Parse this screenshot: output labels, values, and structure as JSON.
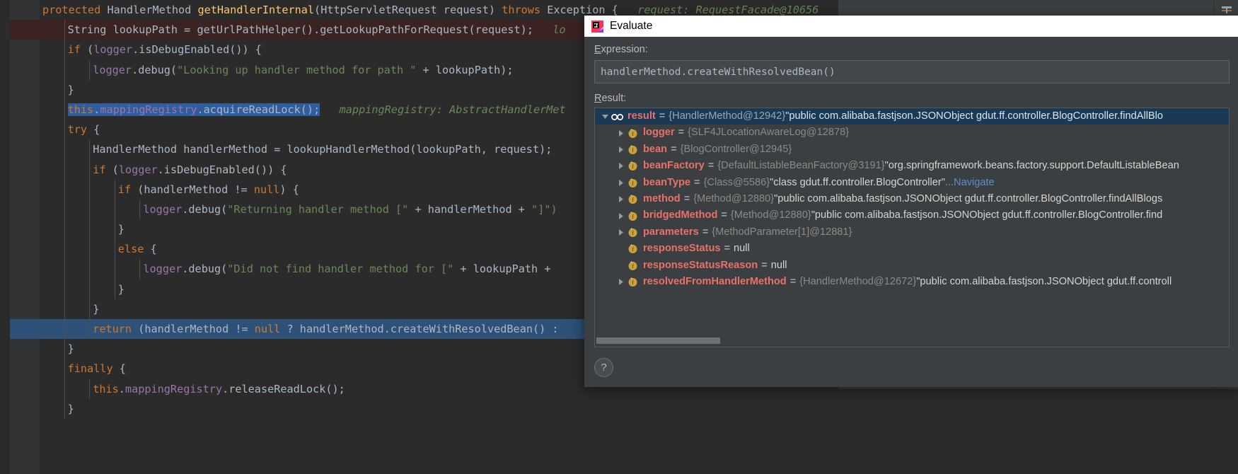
{
  "editor": {
    "language": "java",
    "lines": [
      {
        "indent": 0,
        "highlight": "none",
        "tokens": [
          {
            "t": "protected ",
            "c": "kw"
          },
          {
            "t": "HandlerMethod ",
            "c": "id"
          },
          {
            "t": "getHandlerInternal",
            "c": "fn"
          },
          {
            "t": "(HttpServletRequest request) ",
            "c": "id"
          },
          {
            "t": "throws ",
            "c": "kw"
          },
          {
            "t": "Exception {",
            "c": "id"
          },
          {
            "t": "   request: RequestFacade@10656",
            "c": "inl"
          }
        ]
      },
      {
        "indent": 1,
        "highlight": "brown",
        "tokens": [
          {
            "t": "String lookupPath = ",
            "c": "id"
          },
          {
            "t": "getUrlPathHelper",
            "c": "id"
          },
          {
            "t": "().",
            "c": "id"
          },
          {
            "t": "getLookupPathForRequest",
            "c": "id"
          },
          {
            "t": "(request); ",
            "c": "id"
          },
          {
            "t": "  lo",
            "c": "inl"
          }
        ]
      },
      {
        "indent": 1,
        "highlight": "none",
        "tokens": [
          {
            "t": "if ",
            "c": "kw"
          },
          {
            "t": "(",
            "c": "id"
          },
          {
            "t": "logger",
            "c": "fld"
          },
          {
            "t": ".isDebugEnabled()) {",
            "c": "id"
          }
        ]
      },
      {
        "indent": 2,
        "highlight": "none",
        "tokens": [
          {
            "t": "logger",
            "c": "fld"
          },
          {
            "t": ".debug(",
            "c": "id"
          },
          {
            "t": "\"Looking up handler method for path \"",
            "c": "str"
          },
          {
            "t": " + lookupPath);",
            "c": "id"
          }
        ]
      },
      {
        "indent": 1,
        "highlight": "none",
        "tokens": [
          {
            "t": "}",
            "c": "id"
          }
        ]
      },
      {
        "indent": 1,
        "highlight": "none",
        "selected": true,
        "tokens": [
          {
            "t": "this",
            "c": "kw"
          },
          {
            "t": ".",
            "c": "id"
          },
          {
            "t": "mappingRegistry",
            "c": "fld"
          },
          {
            "t": ".acquireReadLock();",
            "c": "id"
          }
        ],
        "inlay": "   mappingRegistry: AbstractHandlerMet"
      },
      {
        "indent": 1,
        "highlight": "none",
        "tokens": [
          {
            "t": "try ",
            "c": "kw"
          },
          {
            "t": "{",
            "c": "id"
          }
        ]
      },
      {
        "indent": 2,
        "highlight": "none",
        "tokens": [
          {
            "t": "HandlerMethod handlerMethod = lookupHandlerMethod(lookupPath, request);",
            "c": "id"
          }
        ]
      },
      {
        "indent": 2,
        "highlight": "none",
        "tokens": [
          {
            "t": "if ",
            "c": "kw"
          },
          {
            "t": "(",
            "c": "id"
          },
          {
            "t": "logger",
            "c": "fld"
          },
          {
            "t": ".isDebugEnabled()) {",
            "c": "id"
          }
        ]
      },
      {
        "indent": 3,
        "highlight": "none",
        "tokens": [
          {
            "t": "if ",
            "c": "kw"
          },
          {
            "t": "(handlerMethod != ",
            "c": "id"
          },
          {
            "t": "null",
            "c": "kw"
          },
          {
            "t": ") {",
            "c": "id"
          }
        ]
      },
      {
        "indent": 4,
        "highlight": "none",
        "tokens": [
          {
            "t": "logger",
            "c": "fld"
          },
          {
            "t": ".debug(",
            "c": "id"
          },
          {
            "t": "\"Returning handler method [\"",
            "c": "str"
          },
          {
            "t": " + handlerMethod + ",
            "c": "id"
          },
          {
            "t": "\"]\")",
            "c": "str"
          }
        ]
      },
      {
        "indent": 3,
        "highlight": "none",
        "tokens": [
          {
            "t": "}",
            "c": "id"
          }
        ]
      },
      {
        "indent": 3,
        "highlight": "none",
        "tokens": [
          {
            "t": "else ",
            "c": "kw"
          },
          {
            "t": "{",
            "c": "id"
          }
        ]
      },
      {
        "indent": 4,
        "highlight": "none",
        "tokens": [
          {
            "t": "logger",
            "c": "fld"
          },
          {
            "t": ".debug(",
            "c": "id"
          },
          {
            "t": "\"Did not find handler method for [\"",
            "c": "str"
          },
          {
            "t": " + lookupPath + ",
            "c": "id"
          }
        ]
      },
      {
        "indent": 3,
        "highlight": "none",
        "tokens": [
          {
            "t": "}",
            "c": "id"
          }
        ]
      },
      {
        "indent": 2,
        "highlight": "none",
        "tokens": [
          {
            "t": "}",
            "c": "id"
          }
        ]
      },
      {
        "indent": 2,
        "highlight": "exec",
        "tokens": [
          {
            "t": "return ",
            "c": "kw"
          },
          {
            "t": "(handlerMethod != ",
            "c": "id"
          },
          {
            "t": "null",
            "c": "kw"
          },
          {
            "t": " ? handlerMethod.createWithResolvedBean() :",
            "c": "id"
          }
        ]
      },
      {
        "indent": 1,
        "highlight": "none",
        "tokens": [
          {
            "t": "}",
            "c": "id"
          }
        ]
      },
      {
        "indent": 1,
        "highlight": "none",
        "tokens": [
          {
            "t": "finally ",
            "c": "kw"
          },
          {
            "t": "{",
            "c": "id"
          }
        ]
      },
      {
        "indent": 2,
        "highlight": "none",
        "tokens": [
          {
            "t": "this",
            "c": "kw"
          },
          {
            "t": ".",
            "c": "id"
          },
          {
            "t": "mappingRegistry",
            "c": "fld"
          },
          {
            "t": ".releaseReadLock();",
            "c": "id"
          }
        ]
      },
      {
        "indent": 1,
        "highlight": "none",
        "tokens": [
          {
            "t": "}",
            "c": "id"
          }
        ]
      }
    ]
  },
  "dialog": {
    "title": "Evaluate",
    "icon": "intellij-idea-logo",
    "expression_label": "Expression:",
    "expression_value": "handlerMethod.createWithResolvedBean()",
    "result_label": "Result:",
    "help_button_label": "?",
    "tree": [
      {
        "depth": 0,
        "expanded": true,
        "has_toggle": true,
        "icon": "watch-result-icon",
        "name": "result",
        "ref": "{HandlerMethod@12942}",
        "value": "\"public com.alibaba.fastjson.JSONObject gdut.ff.controller.BlogController.findAllBlo",
        "selected": true
      },
      {
        "depth": 1,
        "expanded": false,
        "has_toggle": true,
        "icon": "field-icon",
        "name": "logger",
        "ref": "{SLF4JLocationAwareLog@12878}",
        "value": "",
        "selected": false
      },
      {
        "depth": 1,
        "expanded": false,
        "has_toggle": true,
        "icon": "field-icon",
        "name": "bean",
        "ref": "{BlogController@12945}",
        "value": "",
        "selected": false
      },
      {
        "depth": 1,
        "expanded": false,
        "has_toggle": true,
        "icon": "field-icon",
        "name": "beanFactory",
        "ref": "{DefaultListableBeanFactory@3191}",
        "value": "\"org.springframework.beans.factory.support.DefaultListableBean",
        "selected": false
      },
      {
        "depth": 1,
        "expanded": false,
        "has_toggle": true,
        "icon": "field-icon",
        "name": "beanType",
        "ref": "{Class@5586}",
        "value": "\"class gdut.ff.controller.BlogController\"",
        "ellipsis": "...",
        "link": "Navigate",
        "selected": false
      },
      {
        "depth": 1,
        "expanded": false,
        "has_toggle": true,
        "icon": "field-icon",
        "name": "method",
        "ref": "{Method@12880}",
        "value": "\"public com.alibaba.fastjson.JSONObject gdut.ff.controller.BlogController.findAllBlogs",
        "selected": false
      },
      {
        "depth": 1,
        "expanded": false,
        "has_toggle": true,
        "icon": "field-icon",
        "name": "bridgedMethod",
        "ref": "{Method@12880}",
        "value": "\"public com.alibaba.fastjson.JSONObject gdut.ff.controller.BlogController.find",
        "selected": false
      },
      {
        "depth": 1,
        "expanded": false,
        "has_toggle": true,
        "icon": "field-icon",
        "name": "parameters",
        "ref": "{MethodParameter[1]@12881}",
        "value": "",
        "selected": false
      },
      {
        "depth": 1,
        "expanded": false,
        "has_toggle": false,
        "icon": "field-icon",
        "name": "responseStatus",
        "ref": "",
        "value": "null",
        "selected": false
      },
      {
        "depth": 1,
        "expanded": false,
        "has_toggle": false,
        "icon": "field-icon",
        "name": "responseStatusReason",
        "ref": "",
        "value": "null",
        "selected": false
      },
      {
        "depth": 1,
        "expanded": false,
        "has_toggle": true,
        "icon": "field-icon",
        "name": "resolvedFromHandlerMethod",
        "ref": "{HandlerMethod@12672}",
        "value": "\"public com.alibaba.fastjson.JSONObject gdut.ff.controll",
        "selected": false
      }
    ]
  },
  "colors": {
    "editor_bg": "#2b2b2b",
    "gutter_bg": "#313335",
    "dialog_bg": "#3c3f41",
    "titlebar_bg": "#ffffff",
    "exec_line": "#2d5177",
    "selection": "#2f5d9e",
    "tree_selected": "#1b3855",
    "field_name": "#e8716a",
    "link": "#5b8fc9",
    "keyword": "#cc7832",
    "string": "#6a8759",
    "field": "#9876aa",
    "method": "#ffc66d"
  }
}
